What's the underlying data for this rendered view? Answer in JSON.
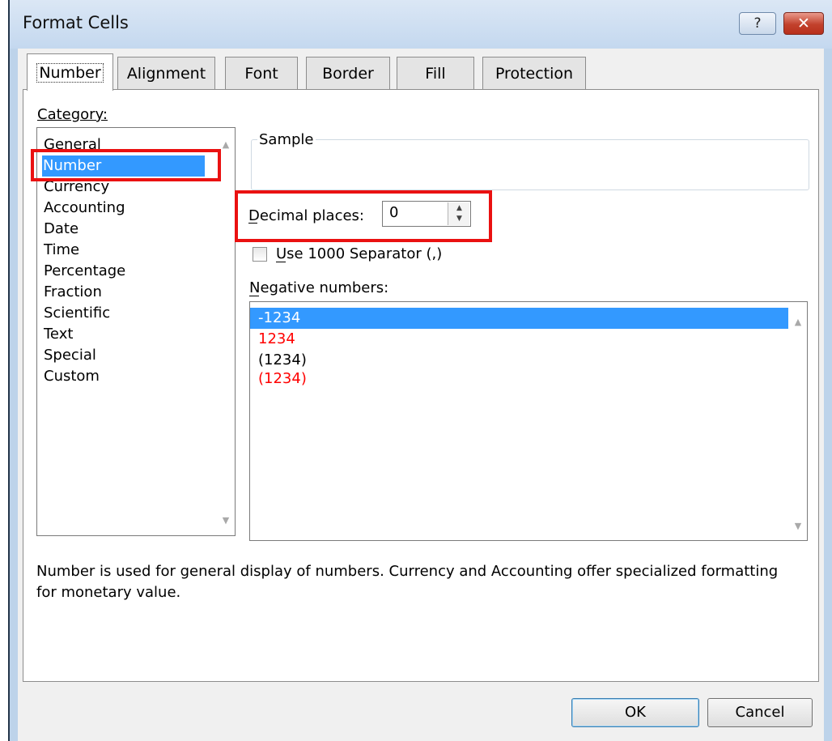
{
  "window": {
    "title": "Format Cells",
    "help_label": "?",
    "close_label": "✕"
  },
  "tabs": [
    {
      "label": "Number",
      "active": true
    },
    {
      "label": "Alignment"
    },
    {
      "label": "Font"
    },
    {
      "label": "Border"
    },
    {
      "label": "Fill"
    },
    {
      "label": "Protection"
    }
  ],
  "category": {
    "label": "Category:",
    "items": [
      "General",
      "Number",
      "Currency",
      "Accounting",
      "Date",
      "Time",
      "Percentage",
      "Fraction",
      "Scientific",
      "Text",
      "Special",
      "Custom"
    ],
    "selected": "Number"
  },
  "sample": {
    "label": "Sample"
  },
  "decimal_places": {
    "label": "Decimal places:",
    "value": "0"
  },
  "separator": {
    "label": "Use 1000 Separator (,)",
    "checked": false
  },
  "negative_numbers": {
    "label": "Negative numbers:",
    "items": [
      {
        "text": "-1234",
        "color": "#000000",
        "selected": true
      },
      {
        "text": "1234",
        "color": "#ff0000"
      },
      {
        "text": "(1234)",
        "color": "#000000"
      },
      {
        "text": "(1234)",
        "color": "#ff0000"
      }
    ]
  },
  "description": "Number is used for general display of numbers.  Currency and Accounting offer specialized formatting for monetary value.",
  "buttons": {
    "ok": "OK",
    "cancel": "Cancel"
  },
  "colors": {
    "selection": "#3399ff",
    "highlight_box": "#ea1111",
    "negative_red": "#ff0000"
  }
}
